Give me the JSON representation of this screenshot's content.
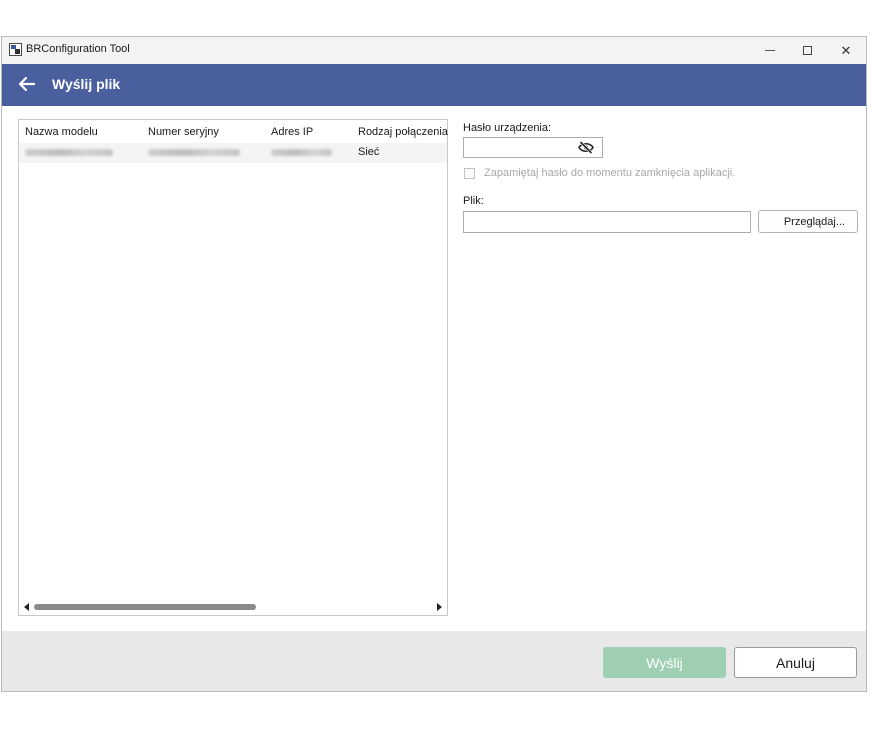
{
  "window": {
    "app_title": "BRConfiguration Tool",
    "app_icon": "brconfiguration-app-icon",
    "controls": {
      "minimize_icon": "minimize-icon",
      "maximize_icon": "maximize-icon",
      "close_glyph": "✕"
    }
  },
  "header": {
    "back_icon": "arrow-left-icon",
    "title": "Wyślij plik",
    "background_color": "#4a5f9e"
  },
  "device_list": {
    "columns": [
      "Nazwa modelu",
      "Numer seryjny",
      "Adres IP",
      "Rodzaj połączenia"
    ],
    "rows": [
      {
        "connection_type": "Sieć"
      }
    ]
  },
  "password": {
    "label": "Hasło urządzenia:",
    "value": "",
    "toggle_icon": "eye-off-icon"
  },
  "remember_password": {
    "label": "Zapamiętaj hasło do momentu zamknięcia aplikacji.",
    "checked": false,
    "disabled": true
  },
  "file": {
    "label": "Plik:",
    "value": "",
    "browse_label": "Przeglądaj..."
  },
  "footer": {
    "send_label": "Wyślij",
    "send_color": "#9fcfb1",
    "cancel_label": "Anuluj"
  }
}
